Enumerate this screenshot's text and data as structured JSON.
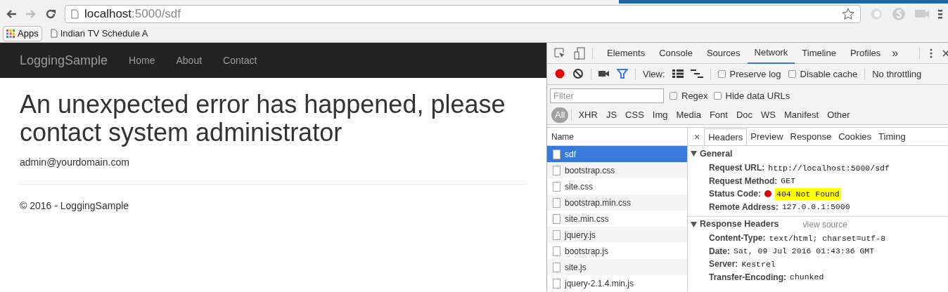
{
  "browser": {
    "address": {
      "host": "localhost",
      "rest": ":5000/sdf"
    },
    "bookmarks": [
      {
        "kind": "apps",
        "label": "Apps"
      },
      {
        "kind": "page",
        "label": "Indian TV Schedule A"
      }
    ]
  },
  "site": {
    "brand": "LoggingSample",
    "nav": [
      "Home",
      "About",
      "Contact"
    ],
    "heading": "An unexpected error has happened, please contact system administrator",
    "email": "admin@yourdomain.com",
    "footer": "© 2016 - LoggingSample"
  },
  "devtools": {
    "tabs": [
      {
        "label": "Elements",
        "selected": false
      },
      {
        "label": "Console",
        "selected": false
      },
      {
        "label": "Sources",
        "selected": false
      },
      {
        "label": "Network",
        "selected": true
      },
      {
        "label": "Timeline",
        "selected": false
      },
      {
        "label": "Profiles",
        "selected": false
      }
    ],
    "more": "»",
    "recording": true,
    "filter_active": true,
    "view_label": "View:",
    "options": [
      {
        "label": "Preserve log",
        "checked": false
      },
      {
        "label": "Disable cache",
        "checked": false
      }
    ],
    "throttling": "No throttling",
    "filter": {
      "placeholder": "Filter"
    },
    "filter_options": [
      {
        "label": "Regex",
        "checked": false
      },
      {
        "label": "Hide data URLs",
        "checked": false
      }
    ],
    "types": [
      {
        "label": "All",
        "selected": true
      },
      {
        "label": "XHR",
        "selected": false
      },
      {
        "label": "JS",
        "selected": false
      },
      {
        "label": "CSS",
        "selected": false
      },
      {
        "label": "Img",
        "selected": false
      },
      {
        "label": "Media",
        "selected": false
      },
      {
        "label": "Font",
        "selected": false
      },
      {
        "label": "Doc",
        "selected": false
      },
      {
        "label": "WS",
        "selected": false
      },
      {
        "label": "Manifest",
        "selected": false
      },
      {
        "label": "Other",
        "selected": false
      }
    ],
    "requests": {
      "column": "Name",
      "items": [
        {
          "name": "sdf",
          "selected": true
        },
        {
          "name": "bootstrap.css",
          "selected": false
        },
        {
          "name": "site.css",
          "selected": false
        },
        {
          "name": "bootstrap.min.css",
          "selected": false
        },
        {
          "name": "site.min.css",
          "selected": false
        },
        {
          "name": "jquery.js",
          "selected": false
        },
        {
          "name": "bootstrap.js",
          "selected": false
        },
        {
          "name": "site.js",
          "selected": false
        },
        {
          "name": "jquery-2.1.4.min.js",
          "selected": false
        }
      ]
    },
    "close": "×",
    "detail_tabs": [
      {
        "label": "Headers",
        "selected": true
      },
      {
        "label": "Preview",
        "selected": false
      },
      {
        "label": "Response",
        "selected": false
      },
      {
        "label": "Cookies",
        "selected": false
      },
      {
        "label": "Timing",
        "selected": false
      }
    ],
    "sections": [
      {
        "title": "General",
        "expanded": true,
        "rows": [
          {
            "key": "Request URL:",
            "value": "http://localhost:5000/sdf"
          },
          {
            "key": "Request Method:",
            "value": "GET"
          },
          {
            "key": "Status Code:",
            "value": "404 Not Found",
            "color": "#e00000",
            "highlighted": true
          },
          {
            "key": "Remote Address:",
            "value": "127.0.0.1:5000"
          }
        ]
      },
      {
        "title": "Response Headers",
        "link": "view source",
        "expanded": true,
        "rows": [
          {
            "key": "Content-Type:",
            "value": "text/html; charset=utf-8"
          },
          {
            "key": "Date:",
            "value": "Sat, 09 Jul 2016 01:43:36 GMT"
          },
          {
            "key": "Server:",
            "value": "Kestrel"
          },
          {
            "key": "Transfer-Encoding:",
            "value": "chunked"
          }
        ]
      }
    ]
  }
}
